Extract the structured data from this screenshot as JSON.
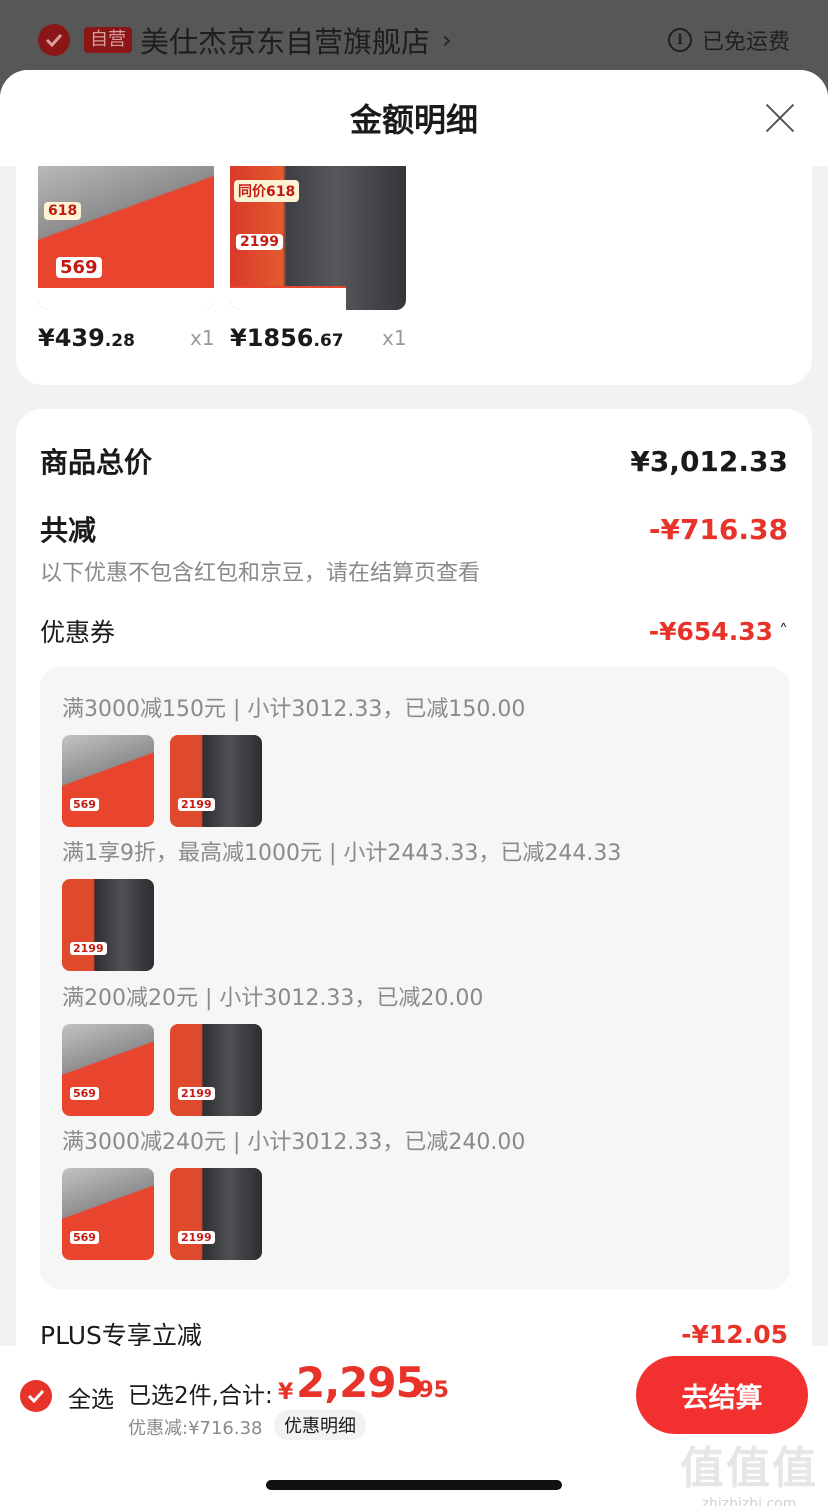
{
  "store": {
    "self_badge": "自营",
    "name": "美仕杰京东自营旗舰店",
    "free_shipping": "已免运费"
  },
  "sheet": {
    "title": "金额明细"
  },
  "products": [
    {
      "price_int": "¥439",
      "price_dec": ".28",
      "qty": "x1",
      "img_tag": "618",
      "img_price": "569"
    },
    {
      "price_int": "¥1856",
      "price_dec": ".67",
      "qty": "x1",
      "img_tag": "同价618",
      "img_price": "2199"
    }
  ],
  "summary": {
    "total_label": "商品总价",
    "total_value": "¥3,012.33",
    "discount_label": "共减",
    "discount_value": "-¥716.38",
    "discount_note": "以下优惠不包含红包和京豆，请在结算页查看",
    "coupon_label": "优惠券",
    "coupon_value": "-¥654.33",
    "coupons": [
      "满3000减150元 | 小计3012.33，已减150.00",
      "满1享9折，最高减1000元 | 小计2443.33，已减244.33",
      "满200减20元 | 小计3012.33，已减20.00",
      "满3000减240元 | 小计3012.33，已减240.00"
    ],
    "plus_label": "PLUS专享立减",
    "plus_value": "-¥12.05"
  },
  "bottom": {
    "select_all": "全选",
    "selected_count": "已选2件,合计:",
    "total_symbol": "¥",
    "total_int": "2,295",
    "total_dec": ".95",
    "discount_text": "优惠减:¥716.38",
    "detail_label": "优惠明细",
    "checkout_label": "去结算"
  },
  "watermark": {
    "mark": "值值值",
    "text": "zhizhizhi.com"
  },
  "colors": {
    "accent": "#e8332a",
    "checkout": "#f23030"
  }
}
